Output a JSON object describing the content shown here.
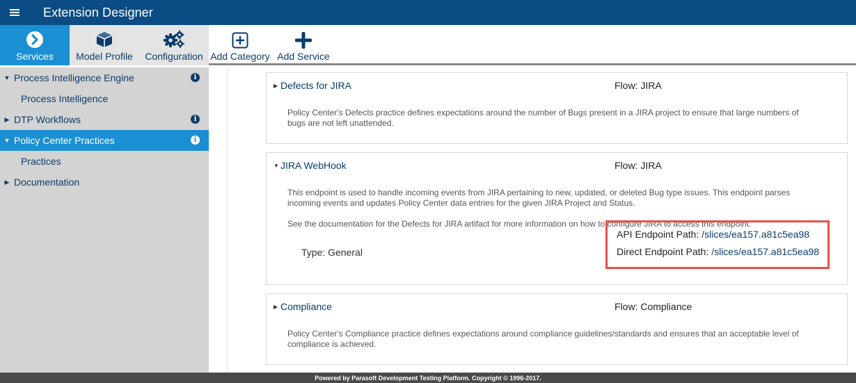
{
  "app": {
    "title": "Extension Designer"
  },
  "toolbar": {
    "services": "Services",
    "model_profile": "Model Profile",
    "configuration": "Configuration",
    "add_category": "Add Category",
    "add_service": "Add Service"
  },
  "sidebar": {
    "items": [
      {
        "label": "Process Intelligence Engine",
        "expanded": true,
        "has_info": true
      },
      {
        "label": "Process Intelligence",
        "child": true
      },
      {
        "label": "DTP Workflows",
        "expanded": false,
        "has_info": true
      },
      {
        "label": "Policy Center Practices",
        "expanded": true,
        "has_info": true,
        "selected": true
      },
      {
        "label": "Practices",
        "child": true
      },
      {
        "label": "Documentation",
        "expanded": false
      }
    ],
    "info_glyph": "i"
  },
  "cards": [
    {
      "title": "Defects for JIRA",
      "flow": "Flow: JIRA",
      "description": "Policy Center's Defects practice defines expectations around the number of Bugs present in a JIRA project to ensure that large numbers of bugs are not left unattended."
    },
    {
      "title": "JIRA WebHook",
      "flow": "Flow: JIRA",
      "description": "This endpoint is used to handle incoming events from JIRA pertaining to new, updated, or deleted Bug type issues. This endpoint parses incoming events and updates Policy Center data entries for the given JIRA Project and Status.",
      "note": "See the documentation for the Defects for JIRA artifact for more information on how to configure JIRA to access this endpoint.",
      "type": "Type: General",
      "api_label": "API Endpoint Path:",
      "api_path": "/slices/ea157.a81c5ea98",
      "direct_label": "Direct Endpoint Path:",
      "direct_path": "/slices/ea157.a81c5ea98"
    },
    {
      "title": "Compliance",
      "flow": "Flow: Compliance",
      "description": "Policy Center's Compliance practice defines expectations around compliance guidelines/standards and ensures that an acceptable level of compliance is achieved."
    }
  ],
  "footer": {
    "text": "Powered by Parasoft Development Testing Platform. Copyright © 1996-2017."
  },
  "colors": {
    "header": "#0b4c84",
    "accent": "#1b8fd4",
    "highlight_border": "#e94f45",
    "link": "#0b3c6b"
  }
}
